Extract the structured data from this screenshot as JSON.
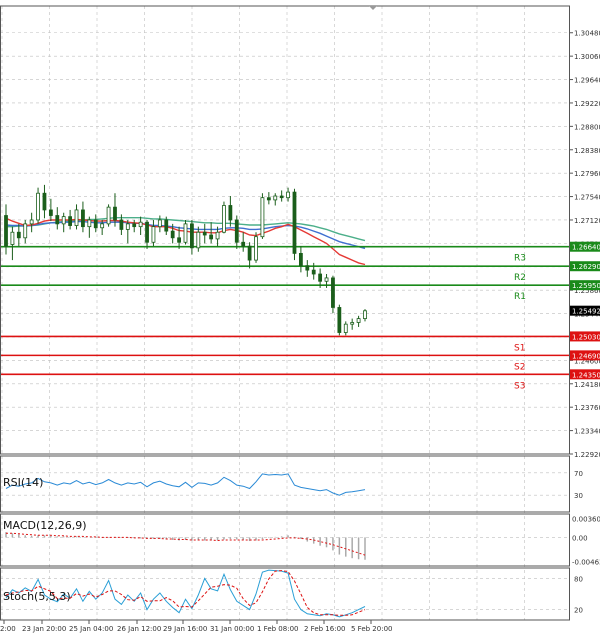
{
  "chart_data": {
    "type": "candlestick",
    "main": {
      "ylim": [
        1.2292,
        1.3096
      ],
      "y_ticks": [
        "1.30480",
        "1.30060",
        "1.29640",
        "1.29220",
        "1.28800",
        "1.28380",
        "1.27960",
        "1.27540",
        "1.27120",
        "1.26700",
        "1.26280",
        "1.25860",
        "1.25440",
        "1.25020",
        "1.24600",
        "1.24180",
        "1.23760",
        "1.23340",
        "1.22920"
      ],
      "levels": [
        {
          "name": "R3",
          "value": 1.2664,
          "label": "1.26640",
          "color": "#1a8a1a"
        },
        {
          "name": "R2",
          "value": 1.2629,
          "label": "1.26290",
          "color": "#1a8a1a"
        },
        {
          "name": "R1",
          "value": 1.2595,
          "label": "1.25950",
          "color": "#1a8a1a"
        },
        {
          "name": "S1",
          "value": 1.2503,
          "label": "1.25030",
          "color": "#dd1111"
        },
        {
          "name": "S2",
          "value": 1.2469,
          "label": "1.24690",
          "color": "#dd1111"
        },
        {
          "name": "S3",
          "value": 1.2435,
          "label": "1.24350",
          "color": "#dd1111"
        }
      ],
      "current_price": {
        "value": 1.25492,
        "label": "1.25492"
      },
      "candles": [
        [
          1.272,
          1.274,
          1.265,
          1.2665
        ],
        [
          1.2668,
          1.27,
          1.264,
          1.269
        ],
        [
          1.269,
          1.2705,
          1.2665,
          1.268
        ],
        [
          1.268,
          1.2712,
          1.267,
          1.2705
        ],
        [
          1.2705,
          1.2725,
          1.269,
          1.2712
        ],
        [
          1.2712,
          1.277,
          1.2705,
          1.276
        ],
        [
          1.276,
          1.2775,
          1.2715,
          1.273
        ],
        [
          1.273,
          1.275,
          1.271,
          1.272
        ],
        [
          1.272,
          1.2735,
          1.2695,
          1.2705
        ],
        [
          1.2705,
          1.2725,
          1.269,
          1.2718
        ],
        [
          1.2718,
          1.273,
          1.2695,
          1.2702
        ],
        [
          1.2702,
          1.274,
          1.2695,
          1.273
        ],
        [
          1.273,
          1.2745,
          1.269,
          1.27
        ],
        [
          1.27,
          1.2718,
          1.268,
          1.2712
        ],
        [
          1.2712,
          1.2722,
          1.269,
          1.2698
        ],
        [
          1.2698,
          1.2712,
          1.2685,
          1.2705
        ],
        [
          1.2705,
          1.274,
          1.27,
          1.2735
        ],
        [
          1.2735,
          1.276,
          1.27,
          1.2712
        ],
        [
          1.2712,
          1.2722,
          1.2685,
          1.2695
        ],
        [
          1.2695,
          1.2712,
          1.267,
          1.2705
        ],
        [
          1.2705,
          1.2712,
          1.269,
          1.27
        ],
        [
          1.27,
          1.2718,
          1.2685,
          1.2708
        ],
        [
          1.2708,
          1.2712,
          1.266,
          1.2672
        ],
        [
          1.2672,
          1.2712,
          1.2665,
          1.27
        ],
        [
          1.27,
          1.272,
          1.269,
          1.2712
        ],
        [
          1.2712,
          1.2718,
          1.2685,
          1.2692
        ],
        [
          1.2692,
          1.2705,
          1.267,
          1.268
        ],
        [
          1.268,
          1.27,
          1.266,
          1.2672
        ],
        [
          1.2672,
          1.2712,
          1.2668,
          1.2705
        ],
        [
          1.2705,
          1.2712,
          1.265,
          1.2662
        ],
        [
          1.2662,
          1.27,
          1.2655,
          1.269
        ],
        [
          1.269,
          1.2705,
          1.267,
          1.2685
        ],
        [
          1.2685,
          1.2708,
          1.267,
          1.2678
        ],
        [
          1.2678,
          1.27,
          1.2665,
          1.269
        ],
        [
          1.269,
          1.2745,
          1.2688,
          1.2738
        ],
        [
          1.2738,
          1.2755,
          1.27,
          1.2712
        ],
        [
          1.2712,
          1.272,
          1.266,
          1.2672
        ],
        [
          1.2672,
          1.269,
          1.2655,
          1.2665
        ],
        [
          1.2665,
          1.2672,
          1.2625,
          1.264
        ],
        [
          1.264,
          1.269,
          1.2635,
          1.2682
        ],
        [
          1.2682,
          1.276,
          1.2678,
          1.2752
        ],
        [
          1.2752,
          1.2762,
          1.274,
          1.2748
        ],
        [
          1.2748,
          1.276,
          1.2738,
          1.2755
        ],
        [
          1.2755,
          1.2765,
          1.2745,
          1.2752
        ],
        [
          1.2752,
          1.277,
          1.2745,
          1.2762
        ],
        [
          1.2762,
          1.2768,
          1.264,
          1.2652
        ],
        [
          1.2652,
          1.2665,
          1.2618,
          1.263
        ],
        [
          1.263,
          1.264,
          1.261,
          1.2622
        ],
        [
          1.2622,
          1.2635,
          1.2605,
          1.2615
        ],
        [
          1.2615,
          1.2625,
          1.259,
          1.2602
        ],
        [
          1.2602,
          1.2615,
          1.259,
          1.2608
        ],
        [
          1.2608,
          1.2612,
          1.2545,
          1.2555
        ],
        [
          1.2555,
          1.256,
          1.2505,
          1.251
        ],
        [
          1.251,
          1.253,
          1.2505,
          1.2525
        ],
        [
          1.2525,
          1.2535,
          1.2515,
          1.2528
        ],
        [
          1.2528,
          1.254,
          1.252,
          1.2535
        ],
        [
          1.2535,
          1.2552,
          1.253,
          1.2549
        ]
      ],
      "ma_fast": [
        1.2715,
        1.271,
        1.2706,
        1.2702,
        1.2703,
        1.2706,
        1.271,
        1.2712,
        1.2712,
        1.2712,
        1.2712,
        1.2713,
        1.2712,
        1.2711,
        1.271,
        1.271,
        1.2711,
        1.2711,
        1.271,
        1.2708,
        1.2707,
        1.2706,
        1.2703,
        1.27,
        1.27,
        1.27,
        1.2697,
        1.2693,
        1.2692,
        1.269,
        1.269,
        1.269,
        1.2689,
        1.2689,
        1.2693,
        1.2695,
        1.2693,
        1.269,
        1.2685,
        1.2684,
        1.2688,
        1.2692,
        1.2697,
        1.27,
        1.2704,
        1.27,
        1.2694,
        1.2688,
        1.2682,
        1.2676,
        1.267,
        1.266,
        1.265,
        1.2645,
        1.264,
        1.2635,
        1.2632
      ],
      "ma_mid": [
        1.2703,
        1.2702,
        1.2702,
        1.2701,
        1.2702,
        1.2704,
        1.2706,
        1.2707,
        1.2707,
        1.2708,
        1.2708,
        1.2709,
        1.2709,
        1.2708,
        1.2707,
        1.2707,
        1.2708,
        1.2708,
        1.2708,
        1.2707,
        1.2706,
        1.2706,
        1.2704,
        1.2702,
        1.2702,
        1.2701,
        1.27,
        1.2698,
        1.2697,
        1.2696,
        1.2695,
        1.2695,
        1.2695,
        1.2695,
        1.2697,
        1.2698,
        1.2698,
        1.2697,
        1.2695,
        1.2695,
        1.2696,
        1.2698,
        1.27,
        1.2701,
        1.2702,
        1.2701,
        1.2699,
        1.2696,
        1.2692,
        1.2688,
        1.2683,
        1.2678,
        1.2673,
        1.267,
        1.2667,
        1.2664,
        1.2661
      ],
      "ma_slow": [
        1.27,
        1.27,
        1.2701,
        1.2701,
        1.2702,
        1.2703,
        1.2705,
        1.2707,
        1.2708,
        1.2709,
        1.271,
        1.2711,
        1.2712,
        1.2713,
        1.2713,
        1.2714,
        1.2715,
        1.2716,
        1.2716,
        1.2716,
        1.2716,
        1.2716,
        1.2715,
        1.2714,
        1.2714,
        1.2713,
        1.2712,
        1.2711,
        1.271,
        1.2709,
        1.2708,
        1.2707,
        1.2707,
        1.2706,
        1.2706,
        1.2706,
        1.2705,
        1.2704,
        1.2703,
        1.2703,
        1.2703,
        1.2704,
        1.2705,
        1.2706,
        1.2707,
        1.2706,
        1.2705,
        1.2703,
        1.2701,
        1.2698,
        1.2695,
        1.2691,
        1.2687,
        1.2684,
        1.2681,
        1.2678,
        1.2675
      ]
    },
    "rsi": {
      "label": "RSI(14)",
      "ticks": [
        "70",
        "30"
      ],
      "ylim": [
        0,
        100
      ],
      "values": [
        42,
        48,
        46,
        50,
        52,
        60,
        54,
        52,
        48,
        52,
        50,
        56,
        50,
        53,
        49,
        52,
        58,
        52,
        48,
        52,
        50,
        53,
        45,
        52,
        55,
        50,
        47,
        45,
        53,
        44,
        52,
        51,
        48,
        52,
        62,
        56,
        48,
        46,
        42,
        54,
        68,
        66,
        67,
        66,
        68,
        48,
        44,
        42,
        40,
        38,
        40,
        34,
        30,
        35,
        36,
        38,
        40
      ]
    },
    "macd": {
      "label": "MACD(12,26,9)",
      "ticks": [
        "0.003607",
        "0.00",
        "-0.004637"
      ],
      "ylim": [
        -0.0055,
        0.0045
      ],
      "histogram": [
        0.001,
        0.0008,
        0.0006,
        0.0004,
        0.0003,
        0.0004,
        0.0004,
        0.0003,
        0.0002,
        0.0002,
        0.0001,
        0.0002,
        0.0001,
        0.0,
        -0.0001,
        -0.0001,
        0.0,
        0.0001,
        0.0,
        -0.0001,
        -0.0001,
        -0.0002,
        -0.0003,
        -0.0003,
        -0.0003,
        -0.0004,
        -0.0005,
        -0.0006,
        -0.0005,
        -0.0006,
        -0.0006,
        -0.0006,
        -0.0006,
        -0.0006,
        -0.0004,
        -0.0003,
        -0.0004,
        -0.0005,
        -0.0007,
        -0.0006,
        -0.0003,
        -0.0001,
        0.0001,
        0.0002,
        0.0004,
        0.0001,
        -0.0003,
        -0.0008,
        -0.0012,
        -0.0016,
        -0.0019,
        -0.0025,
        -0.0033,
        -0.0037,
        -0.004,
        -0.0042,
        -0.0043
      ],
      "signal": [
        0.0008,
        0.0008,
        0.0007,
        0.0006,
        0.0005,
        0.0004,
        0.0004,
        0.0004,
        0.0003,
        0.0003,
        0.0002,
        0.0002,
        0.0002,
        0.0001,
        0.0001,
        0.0,
        0.0,
        0.0,
        0.0,
        0.0,
        -0.0001,
        -0.0001,
        -0.0002,
        -0.0002,
        -0.0002,
        -0.0003,
        -0.0003,
        -0.0004,
        -0.0004,
        -0.0005,
        -0.0005,
        -0.0005,
        -0.0005,
        -0.0006,
        -0.0005,
        -0.0005,
        -0.0005,
        -0.0005,
        -0.0005,
        -0.0005,
        -0.0005,
        -0.0004,
        -0.0003,
        -0.0002,
        -0.0001,
        -0.0001,
        -0.0002,
        -0.0003,
        -0.0005,
        -0.0008,
        -0.0011,
        -0.0014,
        -0.0018,
        -0.0022,
        -0.0026,
        -0.003,
        -0.0034
      ]
    },
    "stoch": {
      "label": "Stoch(5,5,3)",
      "ticks": [
        "80",
        "20"
      ],
      "ylim": [
        0,
        100
      ],
      "main": [
        42,
        58,
        52,
        62,
        55,
        78,
        48,
        40,
        35,
        50,
        42,
        60,
        36,
        55,
        40,
        52,
        76,
        40,
        30,
        48,
        36,
        52,
        20,
        40,
        52,
        36,
        24,
        14,
        40,
        22,
        48,
        80,
        60,
        56,
        88,
        58,
        36,
        28,
        20,
        50,
        92,
        96,
        95,
        94,
        90,
        40,
        20,
        12,
        10,
        8,
        12,
        10,
        6,
        10,
        14,
        20,
        26
      ],
      "signal": [
        48,
        52,
        54,
        57,
        56,
        65,
        60,
        55,
        41,
        42,
        42,
        51,
        46,
        50,
        44,
        49,
        56,
        56,
        49,
        39,
        38,
        45,
        36,
        37,
        37,
        43,
        37,
        25,
        26,
        25,
        37,
        50,
        63,
        65,
        68,
        67,
        61,
        41,
        28,
        33,
        54,
        79,
        94,
        95,
        93,
        75,
        50,
        24,
        14,
        10,
        10,
        10,
        9,
        9,
        10,
        15,
        20
      ]
    },
    "x_ticks": [
      "2:00",
      "23 Jan 20:00",
      "25 Jan 04:00",
      "26 Jan 12:00",
      "29 Jan 16:00",
      "31 Jan 00:00",
      "1 Feb 08:00",
      "2 Feb 16:00",
      "5 Feb 20:00"
    ],
    "colors": {
      "bull": "#1a8a1a",
      "bear": "#dd1111",
      "ma_fast": "#e53935",
      "ma_mid": "#3f6fd0",
      "ma_slow": "#4caf8a",
      "rsi": "#2a8ad6",
      "macd_hist": "#aaaaaa",
      "macd_signal": "#dd1111",
      "stoch_main": "#2a9fd6",
      "stoch_signal": "#dd1111",
      "grid": "#bfbfbf",
      "axis_text": "#333333"
    }
  }
}
